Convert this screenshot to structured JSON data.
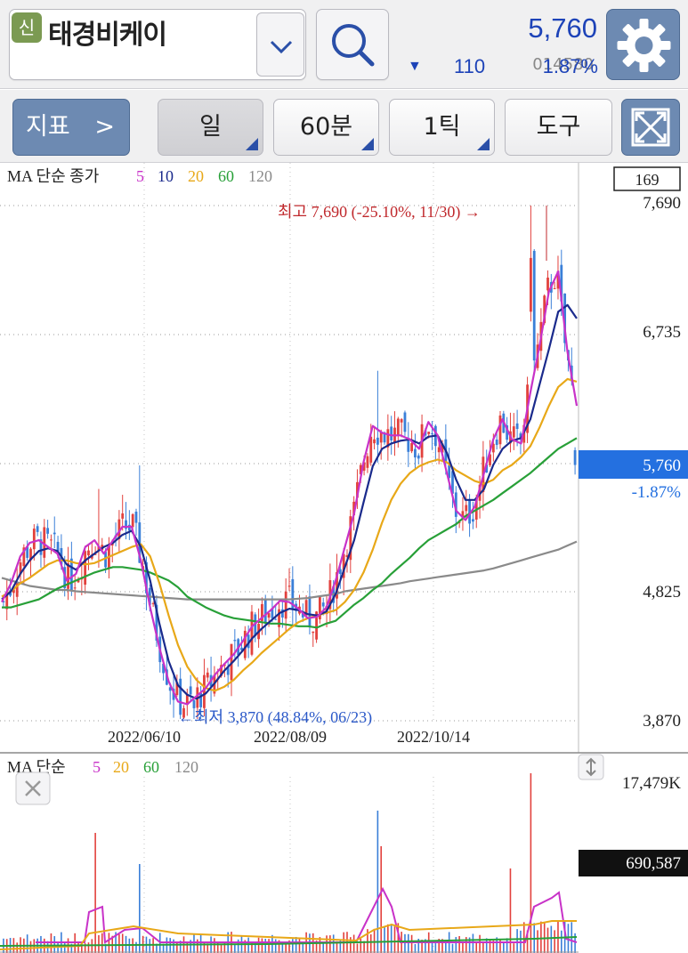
{
  "stock": {
    "badge": "신",
    "name": "태경비케이",
    "code": "014580",
    "price": "5,760",
    "change_arrow": "▼",
    "change": "110",
    "change_pct": "1.87%"
  },
  "toolbar": {
    "indicator": "지표",
    "indicator_arrow": ">",
    "day": "일",
    "minute": "60분",
    "tick": "1틱",
    "tools": "도구"
  },
  "price_chart": {
    "legend_prefix": "MA 단순 종가",
    "legend_periods": [
      "5",
      "10",
      "20",
      "60",
      "120"
    ],
    "legend_colors": [
      "#c832c8",
      "#1a2a8c",
      "#e8a818",
      "#28a038",
      "#8a8a8a"
    ],
    "badge_169": "169",
    "y_labels": [
      "7,690",
      "6,735",
      "5,760",
      "4,825",
      "3,870"
    ],
    "current_pct": "-1.87%",
    "x_labels": [
      "2022/06/10",
      "2022/08/09",
      "2022/10/14"
    ],
    "high_annotation": "최고 7,690 (-25.10%, 11/30) →",
    "low_annotation": "←최저 3,870 (48.84%, 06/23)"
  },
  "volume_chart": {
    "legend_prefix": "MA 단순",
    "legend_periods": [
      "5",
      "20",
      "60",
      "120"
    ],
    "legend_colors": [
      "#c832c8",
      "#e8a818",
      "#28a038",
      "#8a8a8a"
    ],
    "max_label": "17,479K",
    "current_volume": "690,587"
  },
  "chart_data": {
    "type": "candlestick",
    "price_range": [
      3870,
      7690
    ],
    "current_price": 5760,
    "high": {
      "value": 7690,
      "date": "11/30",
      "pct": -25.1
    },
    "low": {
      "value": 3870,
      "date": "06/23",
      "pct": 48.84
    },
    "x_ticks": [
      "2022/06/10",
      "2022/08/09",
      "2022/10/14"
    ],
    "ma5": [
      4740,
      4880,
      5080,
      5180,
      5200,
      5150,
      5100,
      4900,
      4950,
      5150,
      5200,
      5100,
      5200,
      5300,
      5300,
      5050,
      4700,
      4400,
      4150,
      4000,
      3980,
      4040,
      4100,
      4200,
      4280,
      4350,
      4450,
      4560,
      4620,
      4680,
      4750,
      4740,
      4690,
      4620,
      4630,
      4700,
      4900,
      5150,
      5400,
      5780,
      6050,
      6000,
      5980,
      5980,
      5950,
      5880,
      6080,
      5980,
      5700,
      5420,
      5350,
      5450,
      5700,
      5950,
      6100,
      5950,
      5920,
      6300,
      6650,
      7050,
      7200,
      6600,
      6200
    ],
    "ma10": [
      4760,
      4820,
      4950,
      5050,
      5120,
      5140,
      5120,
      5020,
      4980,
      5050,
      5100,
      5150,
      5180,
      5240,
      5270,
      5150,
      4900,
      4580,
      4300,
      4120,
      4050,
      4020,
      4060,
      4140,
      4230,
      4300,
      4380,
      4470,
      4540,
      4600,
      4660,
      4690,
      4680,
      4650,
      4640,
      4670,
      4800,
      5000,
      5200,
      5480,
      5750,
      5880,
      5920,
      5940,
      5950,
      5920,
      5970,
      5980,
      5850,
      5650,
      5500,
      5500,
      5580,
      5760,
      5880,
      5940,
      5960,
      6100,
      6360,
      6620,
      6900,
      6950,
      6850
    ],
    "ma20": [
      4780,
      4820,
      4880,
      4920,
      4970,
      5020,
      5050,
      5050,
      5030,
      5020,
      5030,
      5060,
      5090,
      5120,
      5150,
      5170,
      5080,
      4880,
      4640,
      4420,
      4260,
      4160,
      4100,
      4080,
      4110,
      4160,
      4230,
      4290,
      4360,
      4420,
      4480,
      4540,
      4590,
      4620,
      4640,
      4660,
      4680,
      4740,
      4830,
      4960,
      5130,
      5330,
      5500,
      5620,
      5700,
      5750,
      5780,
      5800,
      5780,
      5720,
      5680,
      5640,
      5620,
      5650,
      5720,
      5760,
      5820,
      5900,
      6040,
      6200,
      6340,
      6400,
      6380
    ],
    "ma60": [
      4700,
      4700,
      4720,
      4740,
      4760,
      4800,
      4840,
      4870,
      4900,
      4930,
      4960,
      4980,
      5000,
      5000,
      4990,
      4980,
      4960,
      4930,
      4900,
      4850,
      4780,
      4740,
      4700,
      4670,
      4640,
      4620,
      4610,
      4600,
      4590,
      4580,
      4580,
      4570,
      4560,
      4560,
      4550,
      4580,
      4600,
      4660,
      4720,
      4770,
      4830,
      4880,
      4950,
      5010,
      5070,
      5140,
      5200,
      5240,
      5280,
      5320,
      5380,
      5420,
      5460,
      5500,
      5550,
      5600,
      5650,
      5700,
      5760,
      5820,
      5880,
      5920,
      5960
    ],
    "ma120": [
      4920,
      4900,
      4880,
      4860,
      4850,
      4840,
      4830,
      4830,
      4820,
      4815,
      4810,
      4805,
      4800,
      4795,
      4790,
      4785,
      4780,
      4775,
      4770,
      4765,
      4760,
      4760,
      4760,
      4760,
      4760,
      4760,
      4760,
      4760,
      4760,
      4760,
      4760,
      4760,
      4765,
      4770,
      4780,
      4790,
      4800,
      4820,
      4830,
      4840,
      4850,
      4860,
      4870,
      4880,
      4895,
      4905,
      4915,
      4925,
      4935,
      4945,
      4955,
      4965,
      4975,
      4990,
      5010,
      5030,
      5050,
      5070,
      5090,
      5110,
      5130,
      5160,
      5190
    ]
  }
}
